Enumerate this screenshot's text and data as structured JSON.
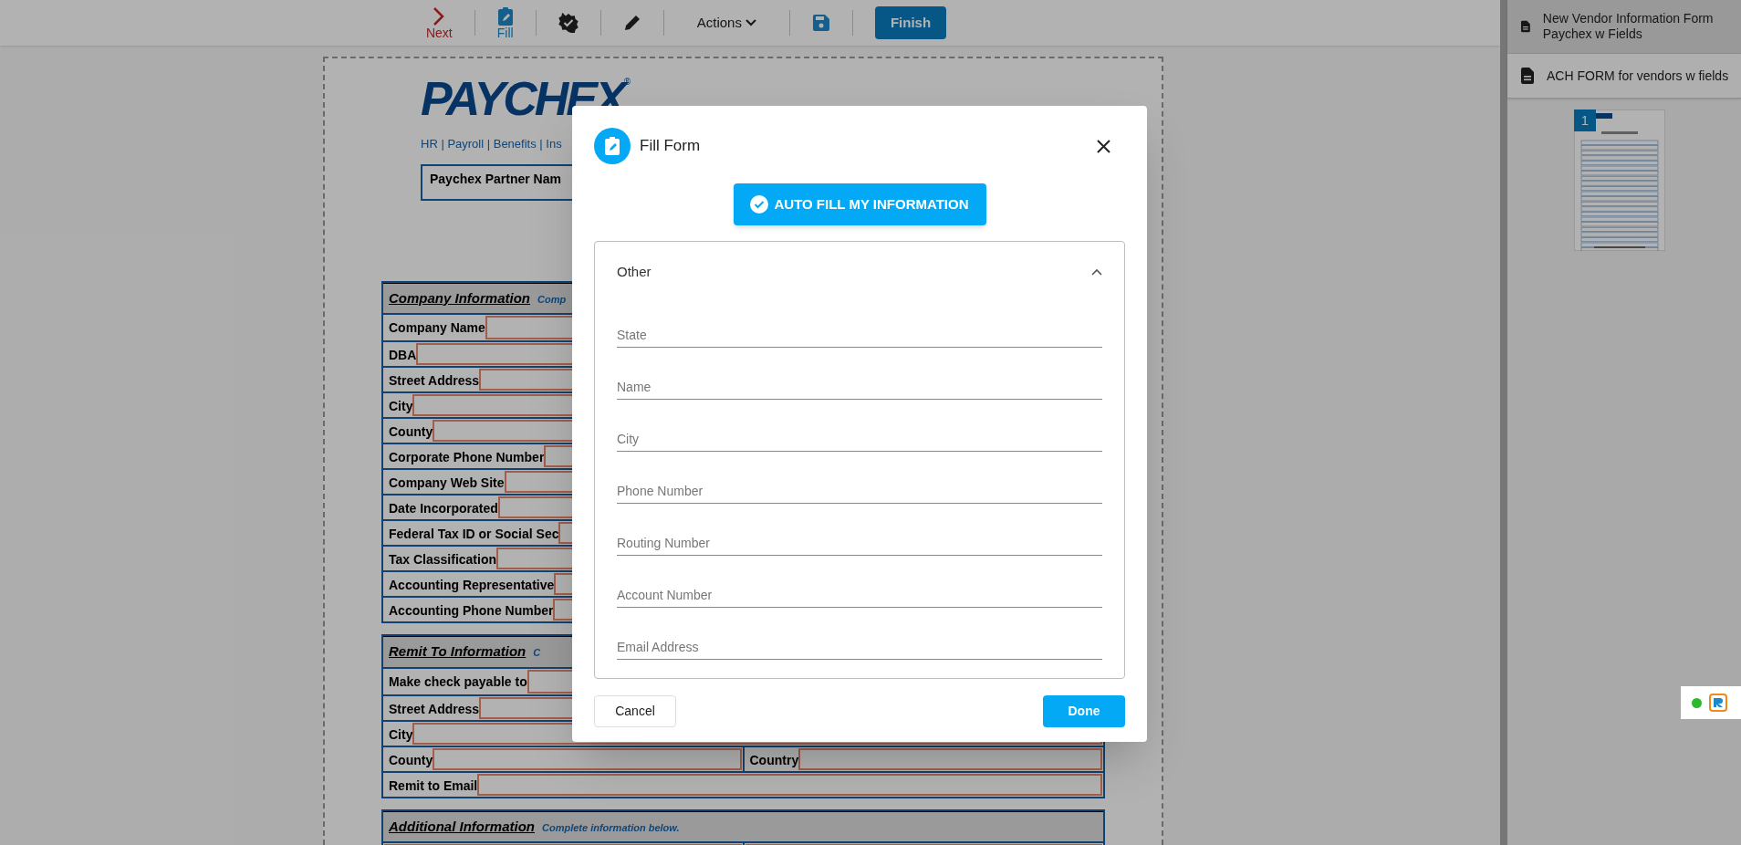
{
  "toolbar": {
    "next_label": "Next",
    "fill_label": "Fill",
    "actions_label": "Actions",
    "finish_label": "Finish"
  },
  "document": {
    "logo": "PAYCHEX",
    "logo_mark": "®",
    "tagline": "HR | Payroll | Benefits | Ins",
    "partner_label": "Paychex Partner Nam",
    "sections": [
      {
        "title": "Company Information",
        "note": "Comp",
        "rows": [
          {
            "cells": [
              {
                "label": "Company Name"
              }
            ]
          },
          {
            "cells": [
              {
                "label": "DBA"
              }
            ]
          },
          {
            "cells": [
              {
                "label": "Street Address"
              }
            ]
          },
          {
            "cells": [
              {
                "label": "City"
              }
            ]
          },
          {
            "cells": [
              {
                "label": "County"
              }
            ]
          },
          {
            "cells": [
              {
                "label": "Corporate Phone Number"
              }
            ]
          },
          {
            "cells": [
              {
                "label": "Company Web Site"
              }
            ]
          },
          {
            "cells": [
              {
                "label": "Date Incorporated"
              }
            ]
          },
          {
            "cells": [
              {
                "label": "Federal Tax ID or Social Sec"
              }
            ]
          },
          {
            "cells": [
              {
                "label": "Tax Classification"
              }
            ]
          },
          {
            "cells": [
              {
                "label": "Accounting Representative"
              }
            ]
          },
          {
            "cells": [
              {
                "label": "Accounting Phone Number"
              }
            ]
          }
        ]
      },
      {
        "title": "Remit To Information",
        "note": "C",
        "rows": [
          {
            "cells": [
              {
                "label": "Make check payable to"
              }
            ]
          },
          {
            "cells": [
              {
                "label": "Street Address"
              }
            ]
          },
          {
            "cells": [
              {
                "label": "City"
              }
            ]
          },
          {
            "cells": [
              {
                "label": "County"
              },
              {
                "label": "Country"
              }
            ]
          },
          {
            "cells": [
              {
                "label": "Remit to Email"
              }
            ]
          }
        ]
      },
      {
        "title": "Additional Information",
        "note": "Complete information below.",
        "rows": [
          {
            "cells": [
              {
                "kind": "empty"
              },
              {
                "kind": "empty"
              }
            ]
          }
        ]
      }
    ]
  },
  "sidebar": {
    "files": [
      {
        "name": "New Vendor Information Form Paychex w Fields",
        "selected": true
      },
      {
        "name": "ACH FORM for vendors w fields",
        "selected": false
      }
    ],
    "page_badge": "1"
  },
  "dialog": {
    "title": "Fill Form",
    "auto_fill_label": "AUTO FILL MY INFORMATION",
    "group": {
      "title": "Other",
      "expanded": true,
      "fields": [
        {
          "placeholder": "State"
        },
        {
          "placeholder": "Name"
        },
        {
          "placeholder": "City"
        },
        {
          "placeholder": "Phone Number"
        },
        {
          "placeholder": "Routing Number"
        },
        {
          "placeholder": "Account Number"
        },
        {
          "placeholder": "Email Address"
        }
      ]
    },
    "cancel_label": "Cancel",
    "done_label": "Done"
  },
  "widget": {
    "online": true
  }
}
